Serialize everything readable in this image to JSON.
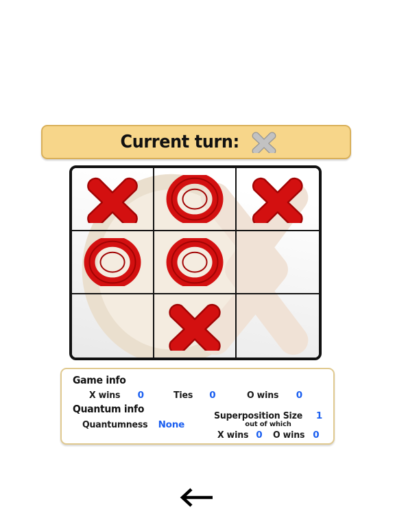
{
  "banner": {
    "label": "Current turn:",
    "mark_icon": "x-mark-gray-icon",
    "mark_player": "X",
    "mark_color": "#c0c0c0",
    "mark_outline_color": "#8f8f8f",
    "background_color": "#f7d68a",
    "border_color": "#d9b05a"
  },
  "board": {
    "mark_color": "#d31010",
    "mark_outline_color": "#a10404",
    "watermark_color": "#f0e3cf",
    "watermark_ring_color": "#e8d8c6",
    "cells": [
      {
        "index": 0,
        "row": 0,
        "col": 0,
        "mark": "X",
        "name": "board-cell-0-0"
      },
      {
        "index": 1,
        "row": 0,
        "col": 1,
        "mark": "O",
        "name": "board-cell-0-1"
      },
      {
        "index": 2,
        "row": 0,
        "col": 2,
        "mark": "X",
        "name": "board-cell-0-2"
      },
      {
        "index": 3,
        "row": 1,
        "col": 0,
        "mark": "O",
        "name": "board-cell-1-0"
      },
      {
        "index": 4,
        "row": 1,
        "col": 1,
        "mark": "O",
        "name": "board-cell-1-1"
      },
      {
        "index": 5,
        "row": 1,
        "col": 2,
        "mark": "",
        "name": "board-cell-1-2"
      },
      {
        "index": 6,
        "row": 2,
        "col": 0,
        "mark": "",
        "name": "board-cell-2-0"
      },
      {
        "index": 7,
        "row": 2,
        "col": 1,
        "mark": "X",
        "name": "board-cell-2-1"
      },
      {
        "index": 8,
        "row": 2,
        "col": 2,
        "mark": "",
        "name": "board-cell-2-2"
      }
    ]
  },
  "info": {
    "game_info_title": "Game info",
    "quantum_info_title": "Quantum info",
    "value_color": "#1b5ff0",
    "game_stats": {
      "x_wins_label": "X wins",
      "x_wins_value": "0",
      "ties_label": "Ties",
      "ties_value": "0",
      "o_wins_label": "O wins",
      "o_wins_value": "0"
    },
    "quantum": {
      "quantumness_label": "Quantumness",
      "quantumness_value": "None",
      "superposition_label": "Superposition Size",
      "superposition_value": "1",
      "out_of_which_label": "out of which",
      "sp_x_wins_label": "X wins",
      "sp_x_wins_value": "0",
      "sp_o_wins_label": "O wins",
      "sp_o_wins_value": "0"
    }
  },
  "nav": {
    "back_label": "←",
    "back_icon": "arrow-left-icon"
  }
}
